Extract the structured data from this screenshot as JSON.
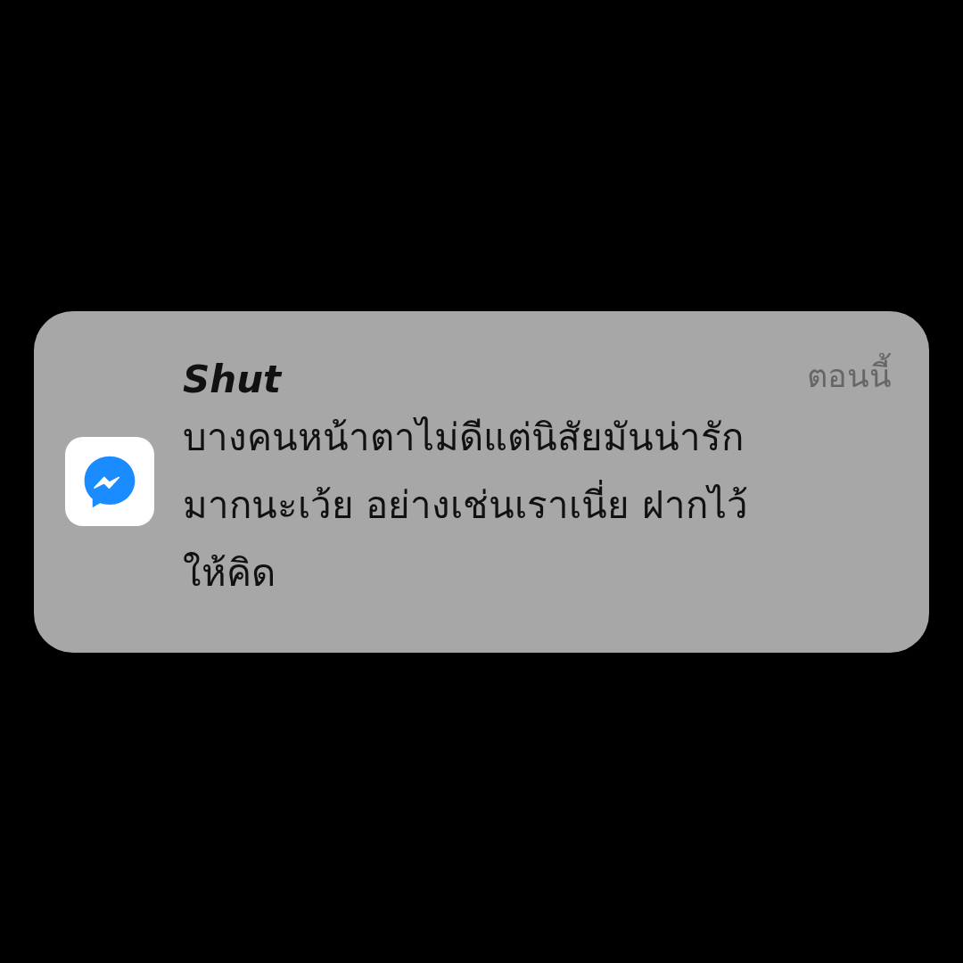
{
  "notification": {
    "sender": "Shut",
    "time": "ตอนนี้",
    "message_lines": [
      "บางคนหน้าตาไม่ดีแต่นิสัยมันน่ารัก",
      "มากนะเว้ย อย่างเช่นเราเนี่ย ฝากไว้",
      "ให้คิด"
    ]
  }
}
